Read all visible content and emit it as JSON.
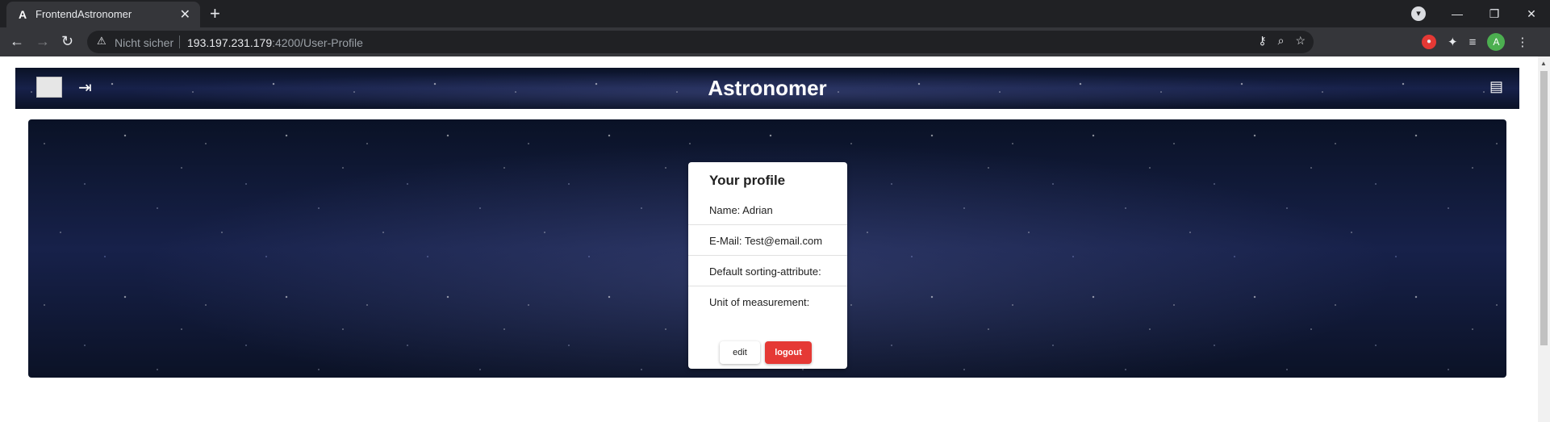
{
  "browser": {
    "tab_title": "FrontendAstronomer",
    "tab_favicon": "A",
    "security_label": "Nicht sicher",
    "url_host": "193.197.231.179",
    "url_rest": ":4200/User-Profile",
    "avatar_letter": "A"
  },
  "header": {
    "brand": "Astronomer"
  },
  "profile": {
    "title": "Your profile",
    "name_label": "Name: Adrian",
    "email_label": "E-Mail: Test@email.com",
    "sorting_label": "Default sorting-attribute:",
    "unit_label": "Unit of measurement:",
    "edit_label": "edit",
    "logout_label": "logout"
  },
  "colors": {
    "logout_button": "#e53935",
    "chrome_dark": "#202124"
  }
}
